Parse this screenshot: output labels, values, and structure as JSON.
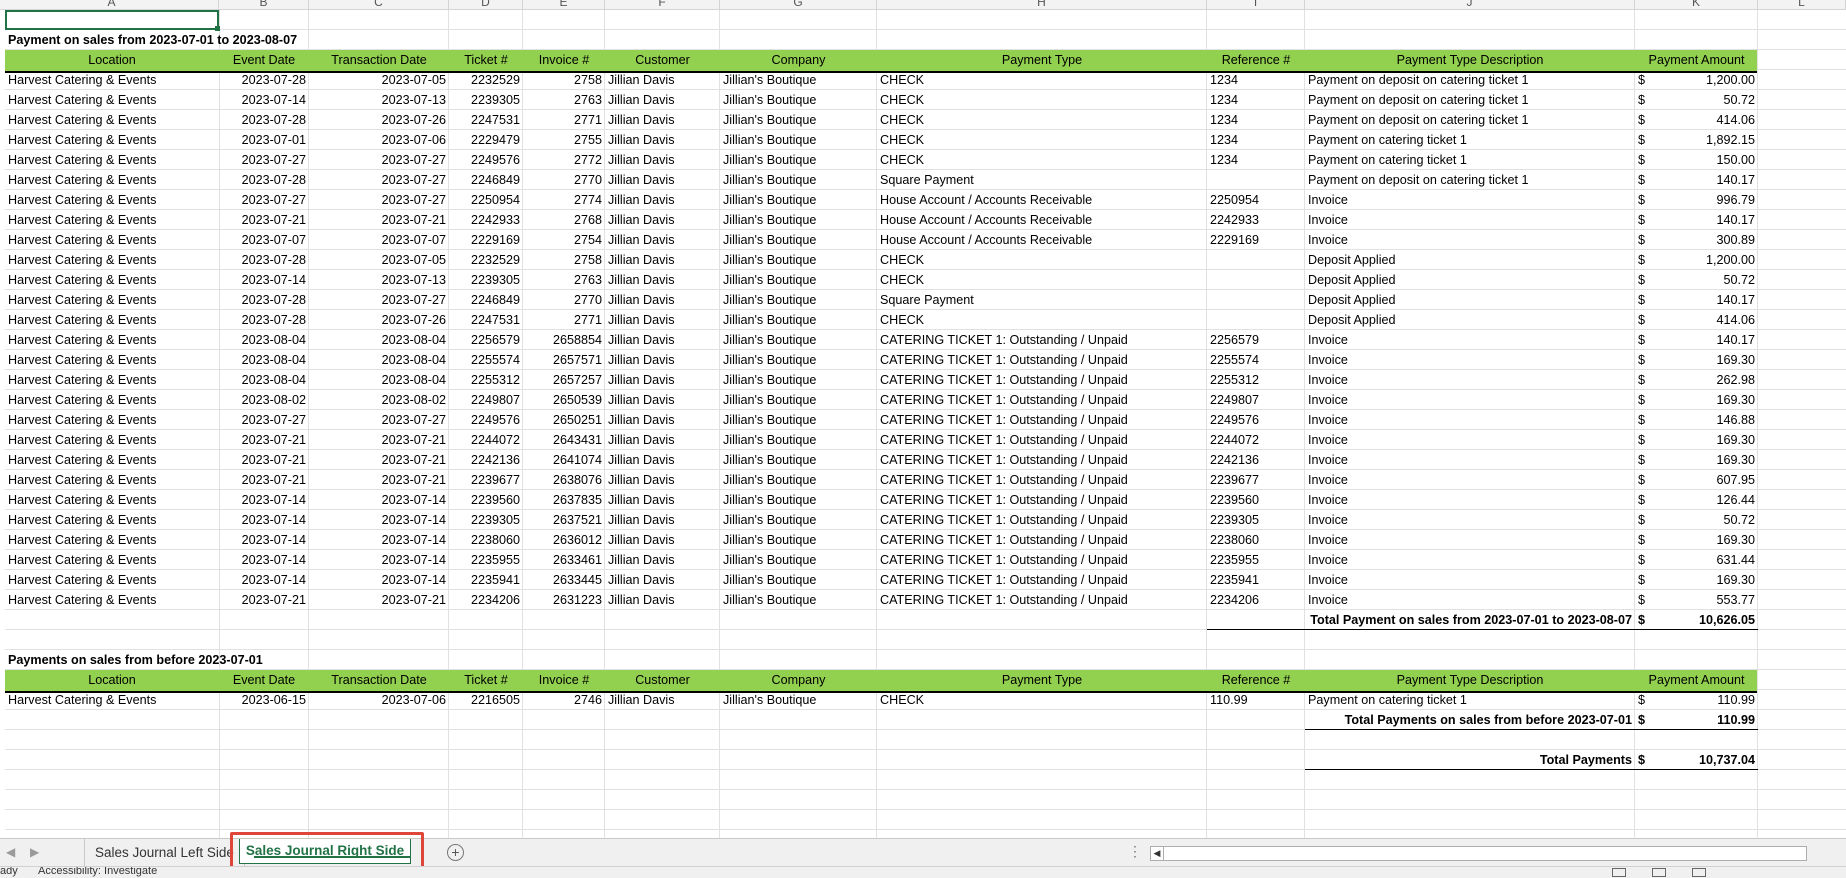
{
  "column_letters": [
    "A",
    "B",
    "C",
    "D",
    "E",
    "F",
    "G",
    "H",
    "I",
    "J",
    "K",
    "L"
  ],
  "section1": {
    "title": "Payment on sales from 2023-07-01 to 2023-08-07",
    "total_label": "Total Payment on sales from 2023-07-01 to 2023-08-07",
    "total_currency": "$",
    "total_amount": "10,626.05"
  },
  "headers": [
    "Location",
    "Event Date",
    "Transaction Date",
    "Ticket #",
    "Invoice #",
    "Customer",
    "Company",
    "Payment Type",
    "Reference #",
    "Payment Type Description",
    "Payment Amount"
  ],
  "section1_rows": [
    [
      "Harvest Catering & Events",
      "2023-07-28",
      "2023-07-05",
      "2232529",
      "2758",
      "Jillian Davis",
      "Jillian's Boutique",
      "CHECK",
      "1234",
      "Payment on deposit on catering ticket 1",
      "$",
      "1,200.00"
    ],
    [
      "Harvest Catering & Events",
      "2023-07-14",
      "2023-07-13",
      "2239305",
      "2763",
      "Jillian Davis",
      "Jillian's Boutique",
      "CHECK",
      "1234",
      "Payment on deposit on catering ticket 1",
      "$",
      "50.72"
    ],
    [
      "Harvest Catering & Events",
      "2023-07-28",
      "2023-07-26",
      "2247531",
      "2771",
      "Jillian Davis",
      "Jillian's Boutique",
      "CHECK",
      "1234",
      "Payment on deposit on catering ticket 1",
      "$",
      "414.06"
    ],
    [
      "Harvest Catering & Events",
      "2023-07-01",
      "2023-07-06",
      "2229479",
      "2755",
      "Jillian Davis",
      "Jillian's Boutique",
      "CHECK",
      "1234",
      "Payment on catering ticket 1",
      "$",
      "1,892.15"
    ],
    [
      "Harvest Catering & Events",
      "2023-07-27",
      "2023-07-27",
      "2249576",
      "2772",
      "Jillian Davis",
      "Jillian's Boutique",
      "CHECK",
      "1234",
      "Payment on catering ticket 1",
      "$",
      "150.00"
    ],
    [
      "Harvest Catering & Events",
      "2023-07-28",
      "2023-07-27",
      "2246849",
      "2770",
      "Jillian Davis",
      "Jillian's Boutique",
      "Square Payment",
      "",
      "Payment on deposit on catering ticket 1",
      "$",
      "140.17"
    ],
    [
      "Harvest Catering & Events",
      "2023-07-27",
      "2023-07-27",
      "2250954",
      "2774",
      "Jillian Davis",
      "Jillian's Boutique",
      "House Account / Accounts Receivable",
      "2250954",
      "Invoice",
      "$",
      "996.79"
    ],
    [
      "Harvest Catering & Events",
      "2023-07-21",
      "2023-07-21",
      "2242933",
      "2768",
      "Jillian Davis",
      "Jillian's Boutique",
      "House Account / Accounts Receivable",
      "2242933",
      "Invoice",
      "$",
      "140.17"
    ],
    [
      "Harvest Catering & Events",
      "2023-07-07",
      "2023-07-07",
      "2229169",
      "2754",
      "Jillian Davis",
      "Jillian's Boutique",
      "House Account / Accounts Receivable",
      "2229169",
      "Invoice",
      "$",
      "300.89"
    ],
    [
      "Harvest Catering & Events",
      "2023-07-28",
      "2023-07-05",
      "2232529",
      "2758",
      "Jillian Davis",
      "Jillian's Boutique",
      "CHECK",
      "",
      "Deposit Applied",
      "$",
      "1,200.00"
    ],
    [
      "Harvest Catering & Events",
      "2023-07-14",
      "2023-07-13",
      "2239305",
      "2763",
      "Jillian Davis",
      "Jillian's Boutique",
      "CHECK",
      "",
      "Deposit Applied",
      "$",
      "50.72"
    ],
    [
      "Harvest Catering & Events",
      "2023-07-28",
      "2023-07-27",
      "2246849",
      "2770",
      "Jillian Davis",
      "Jillian's Boutique",
      "Square Payment",
      "",
      "Deposit Applied",
      "$",
      "140.17"
    ],
    [
      "Harvest Catering & Events",
      "2023-07-28",
      "2023-07-26",
      "2247531",
      "2771",
      "Jillian Davis",
      "Jillian's Boutique",
      "CHECK",
      "",
      "Deposit Applied",
      "$",
      "414.06"
    ],
    [
      "Harvest Catering & Events",
      "2023-08-04",
      "2023-08-04",
      "2256579",
      "2658854",
      "Jillian Davis",
      "Jillian's Boutique",
      "CATERING TICKET 1: Outstanding / Unpaid",
      "2256579",
      "Invoice",
      "$",
      "140.17"
    ],
    [
      "Harvest Catering & Events",
      "2023-08-04",
      "2023-08-04",
      "2255574",
      "2657571",
      "Jillian Davis",
      "Jillian's Boutique",
      "CATERING TICKET 1: Outstanding / Unpaid",
      "2255574",
      "Invoice",
      "$",
      "169.30"
    ],
    [
      "Harvest Catering & Events",
      "2023-08-04",
      "2023-08-04",
      "2255312",
      "2657257",
      "Jillian Davis",
      "Jillian's Boutique",
      "CATERING TICKET 1: Outstanding / Unpaid",
      "2255312",
      "Invoice",
      "$",
      "262.98"
    ],
    [
      "Harvest Catering & Events",
      "2023-08-02",
      "2023-08-02",
      "2249807",
      "2650539",
      "Jillian Davis",
      "Jillian's Boutique",
      "CATERING TICKET 1: Outstanding / Unpaid",
      "2249807",
      "Invoice",
      "$",
      "169.30"
    ],
    [
      "Harvest Catering & Events",
      "2023-07-27",
      "2023-07-27",
      "2249576",
      "2650251",
      "Jillian Davis",
      "Jillian's Boutique",
      "CATERING TICKET 1: Outstanding / Unpaid",
      "2249576",
      "Invoice",
      "$",
      "146.88"
    ],
    [
      "Harvest Catering & Events",
      "2023-07-21",
      "2023-07-21",
      "2244072",
      "2643431",
      "Jillian Davis",
      "Jillian's Boutique",
      "CATERING TICKET 1: Outstanding / Unpaid",
      "2244072",
      "Invoice",
      "$",
      "169.30"
    ],
    [
      "Harvest Catering & Events",
      "2023-07-21",
      "2023-07-21",
      "2242136",
      "2641074",
      "Jillian Davis",
      "Jillian's Boutique",
      "CATERING TICKET 1: Outstanding / Unpaid",
      "2242136",
      "Invoice",
      "$",
      "169.30"
    ],
    [
      "Harvest Catering & Events",
      "2023-07-21",
      "2023-07-21",
      "2239677",
      "2638076",
      "Jillian Davis",
      "Jillian's Boutique",
      "CATERING TICKET 1: Outstanding / Unpaid",
      "2239677",
      "Invoice",
      "$",
      "607.95"
    ],
    [
      "Harvest Catering & Events",
      "2023-07-14",
      "2023-07-14",
      "2239560",
      "2637835",
      "Jillian Davis",
      "Jillian's Boutique",
      "CATERING TICKET 1: Outstanding / Unpaid",
      "2239560",
      "Invoice",
      "$",
      "126.44"
    ],
    [
      "Harvest Catering & Events",
      "2023-07-14",
      "2023-07-14",
      "2239305",
      "2637521",
      "Jillian Davis",
      "Jillian's Boutique",
      "CATERING TICKET 1: Outstanding / Unpaid",
      "2239305",
      "Invoice",
      "$",
      "50.72"
    ],
    [
      "Harvest Catering & Events",
      "2023-07-14",
      "2023-07-14",
      "2238060",
      "2636012",
      "Jillian Davis",
      "Jillian's Boutique",
      "CATERING TICKET 1: Outstanding / Unpaid",
      "2238060",
      "Invoice",
      "$",
      "169.30"
    ],
    [
      "Harvest Catering & Events",
      "2023-07-14",
      "2023-07-14",
      "2235955",
      "2633461",
      "Jillian Davis",
      "Jillian's Boutique",
      "CATERING TICKET 1: Outstanding / Unpaid",
      "2235955",
      "Invoice",
      "$",
      "631.44"
    ],
    [
      "Harvest Catering & Events",
      "2023-07-14",
      "2023-07-14",
      "2235941",
      "2633445",
      "Jillian Davis",
      "Jillian's Boutique",
      "CATERING TICKET 1: Outstanding / Unpaid",
      "2235941",
      "Invoice",
      "$",
      "169.30"
    ],
    [
      "Harvest Catering & Events",
      "2023-07-21",
      "2023-07-21",
      "2234206",
      "2631223",
      "Jillian Davis",
      "Jillian's Boutique",
      "CATERING TICKET 1: Outstanding / Unpaid",
      "2234206",
      "Invoice",
      "$",
      "553.77"
    ]
  ],
  "section2": {
    "title": "Payments on sales from before 2023-07-01",
    "total_label": "Total Payments on sales from before 2023-07-01",
    "total_currency": "$",
    "total_amount": "110.99"
  },
  "section2_rows": [
    [
      "Harvest Catering & Events",
      "2023-06-15",
      "2023-07-06",
      "2216505",
      "2746",
      "Jillian Davis",
      "Jillian's Boutique",
      "CHECK",
      "110.99",
      "Payment on catering ticket 1",
      "$",
      "110.99"
    ]
  ],
  "grand_total": {
    "label": "Total Payments",
    "currency": "$",
    "amount": "10,737.04"
  },
  "sheet_tabs": {
    "left": "Sales Journal Left Side",
    "right": "Sales Journal Right Side",
    "add": "+",
    "more": "⋮"
  },
  "status_bar": {
    "ready": "ady",
    "accessibility": "Accessibility: Investigate"
  },
  "colors": {
    "header_fill": "#92d050",
    "active_tab": "#217346",
    "highlight_box": "#e0453a"
  }
}
